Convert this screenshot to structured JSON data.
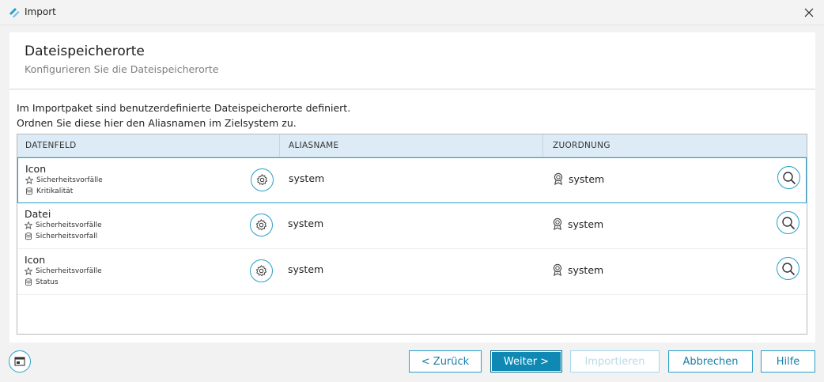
{
  "window": {
    "title": "Import"
  },
  "header": {
    "title": "Dateispeicherorte",
    "subtitle": "Konfigurieren Sie die Dateispeicherorte"
  },
  "intro": {
    "line1": "Im Importpaket sind benutzerdefinierte Dateispeicherorte definiert.",
    "line2": "Ordnen Sie diese hier den Aliasnamen im Zielsystem zu."
  },
  "grid": {
    "columns": [
      "DATENFELD",
      "ALIASNAME",
      "ZUORDNUNG"
    ],
    "rows": [
      {
        "title": "Icon",
        "module": "Sicherheitsvorfälle",
        "table": "Kritikalität",
        "alias": "system",
        "assignment": "system",
        "selected": true
      },
      {
        "title": "Datei",
        "module": "Sicherheitsvorfälle",
        "table": "Sicherheitsvorfall",
        "alias": "system",
        "assignment": "system",
        "selected": false
      },
      {
        "title": "Icon",
        "module": "Sicherheitsvorfälle",
        "table": "Status",
        "alias": "system",
        "assignment": "system",
        "selected": false
      }
    ]
  },
  "buttons": {
    "back": "< Zurück",
    "next": "Weiter >",
    "import": "Importieren",
    "cancel": "Abbrechen",
    "help": "Hilfe"
  },
  "colors": {
    "accent": "#2a9fc9",
    "primary": "#0f89b4",
    "header_bg": "#dcebf6"
  },
  "icons": {
    "app": "app-logo-icon",
    "close": "close-icon",
    "module": "star-ribbon-icon",
    "table": "database-icon",
    "settings": "gear-icon",
    "assignment": "badge-icon",
    "search": "magnifier-icon",
    "view": "window-layout-icon"
  }
}
